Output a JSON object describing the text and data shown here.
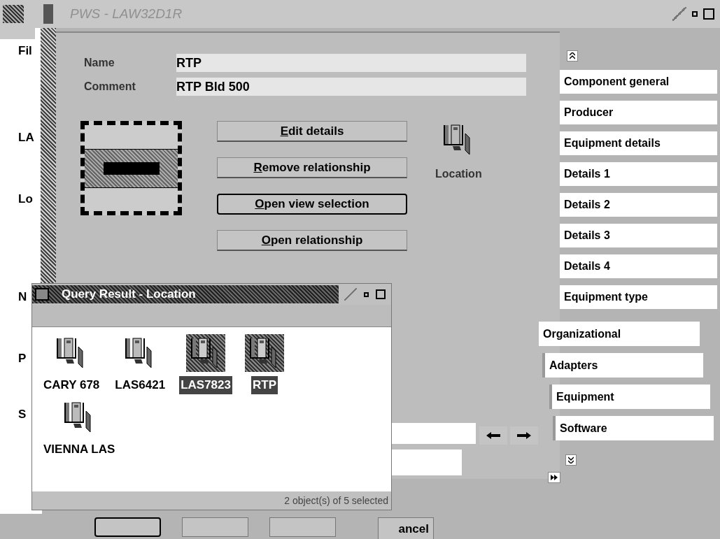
{
  "main_window": {
    "title": "PWS - LAW32D1R",
    "labels": [
      "Fil",
      "LA",
      "Lo",
      "N",
      "P",
      "S"
    ],
    "cancel_button": "ancel"
  },
  "notebook": {
    "fields": [
      {
        "label": "Name",
        "value": "RTP"
      },
      {
        "label": "Comment",
        "value": "RTP Bld 500"
      }
    ],
    "buttons": [
      {
        "label": "Edit details",
        "focused": false
      },
      {
        "label": "Remove relationship",
        "focused": false
      },
      {
        "label": "Open view selection",
        "focused": true
      },
      {
        "label": "Open relationship",
        "focused": false
      }
    ],
    "location_label": "Location",
    "tabs": [
      {
        "label": "Component general",
        "selected": false
      },
      {
        "label": "Producer",
        "selected": false
      },
      {
        "label": "Equipment details",
        "selected": false
      },
      {
        "label": "Details 1",
        "selected": false
      },
      {
        "label": "Details 2",
        "selected": false
      },
      {
        "label": "Details 3",
        "selected": false
      },
      {
        "label": "Details 4",
        "selected": false
      },
      {
        "label": "Equipment type",
        "selected": false
      }
    ],
    "major_tabs": [
      {
        "label": "Organizational",
        "selected": true
      },
      {
        "label": "Adapters",
        "selected": false
      },
      {
        "label": "Equipment",
        "selected": false
      },
      {
        "label": "Software",
        "selected": false
      }
    ]
  },
  "query_window": {
    "title": "Query Result - Location",
    "items": [
      {
        "label": "CARY 678",
        "selected": false
      },
      {
        "label": "LAS6421",
        "selected": false
      },
      {
        "label": "LAS7823",
        "selected": true
      },
      {
        "label": "RTP",
        "selected": true
      },
      {
        "label": "VIENNA LAS",
        "selected": false
      }
    ],
    "status": "2 object(s) of 5 selected"
  }
}
